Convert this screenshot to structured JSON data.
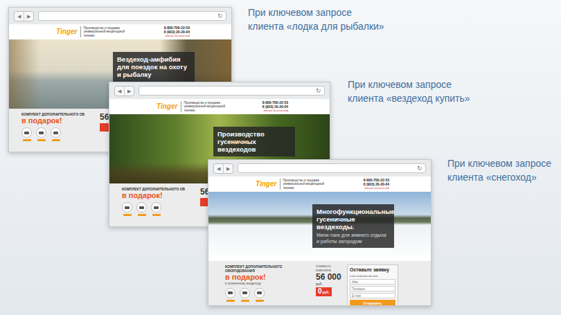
{
  "captions": [
    {
      "lines": [
        "При ключевом запросе",
        "клиента «лодка для рыбалки»"
      ]
    },
    {
      "lines": [
        "При ключевом запросе",
        "клиента «вездеход купить»"
      ]
    },
    {
      "lines": [
        "При ключевом запросе",
        "клиента «снегоход»"
      ]
    }
  ],
  "windows": [
    {
      "back": "◀",
      "forward": "▶",
      "refresh": "↻",
      "site": {
        "logo": "Tinger",
        "tagline": "Производство и продажа универсальной вездеходной техники",
        "phones": [
          "8-800-700-22-53",
          "8 (903) 20-20-04"
        ],
        "phone_note": "звонок бесплатный"
      },
      "hero": {
        "kind": "lake",
        "title": "Вездеход-амфибия для поездок на охоту и рыбалку"
      },
      "offer": {
        "heading": "КОМПЛЕКТ ДОПОЛНИТЕЛЬНОГО ОБ",
        "gift": "в подарок!",
        "price": "56"
      }
    },
    {
      "back": "◀",
      "forward": "▶",
      "refresh": "↻",
      "site": {
        "logo": "Tinger",
        "tagline": "Производство и продажа универсальной вездеходной техники",
        "phones": [
          "8-800-700-22-53",
          "8 (903) 20-20-04"
        ],
        "phone_note": "звонок бесплатный"
      },
      "hero": {
        "kind": "forest",
        "title": "Производство гусеничных вездеходов"
      },
      "offer": {
        "heading": "КОМПЛЕКТ ДОПОЛНИТЕЛЬНОГО ОБ",
        "gift": "в подарок!",
        "price": "56"
      }
    },
    {
      "back": "◀",
      "forward": "▶",
      "refresh": "↻",
      "site": {
        "logo": "Tinger",
        "tagline": "Производство и продажа универсальной вездеходной техники",
        "phones": [
          "8-800-700-22-53",
          "8 (903) 20-20-04"
        ],
        "phone_note": "звонок бесплатный"
      },
      "hero": {
        "kind": "snow",
        "title": "Многофункциональные гусеничные вездеходы.",
        "subtitle": "Мини-танк для зимнего отдыха и работы загородом"
      },
      "offer": {
        "heading": "КОМПЛЕКТ ДОПОЛНИТЕЛЬНОГО ОБОРУДОВАНИЯ",
        "gift": "в подарок!",
        "gift_note": "к гусеничному вездеходу",
        "price_label": "стоимость комплекта",
        "price": "56 000",
        "currency": "руб.",
        "new_price": "0",
        "new_currency": "руб.",
        "form": {
          "title": "Оставьте заявку",
          "note": "и мы перезвоним вам",
          "fields": [
            "Имя",
            "Телефон",
            "E-mail"
          ],
          "button": "Отправить"
        }
      }
    }
  ]
}
